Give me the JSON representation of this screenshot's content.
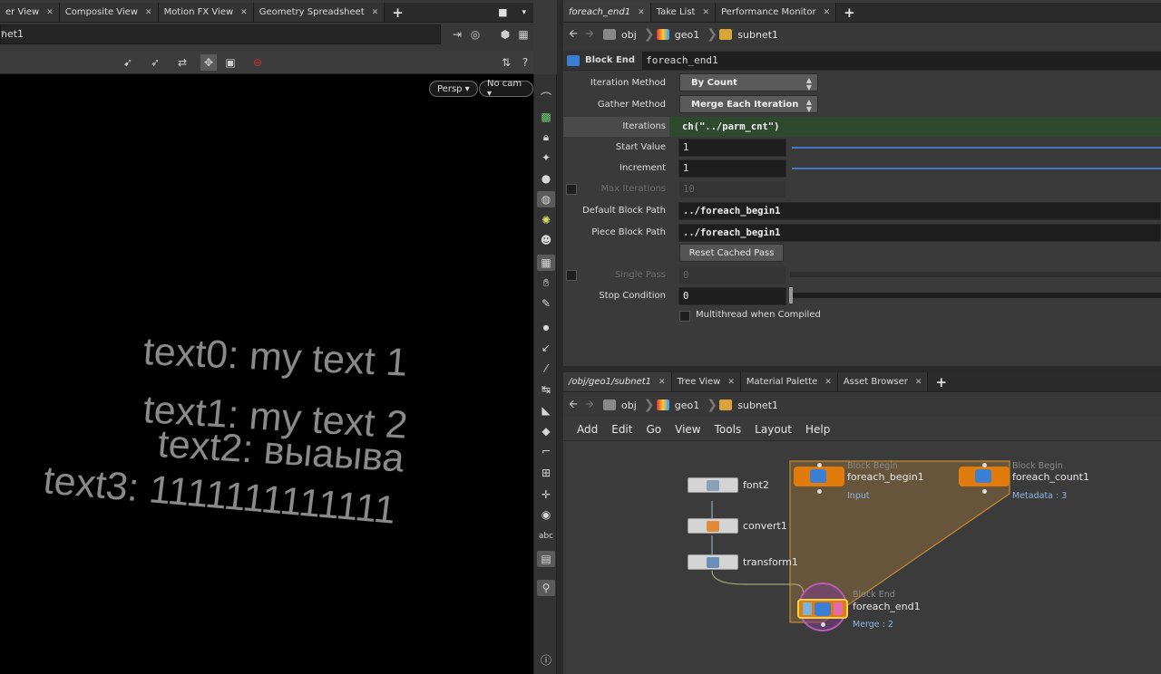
{
  "left_tabs": [
    {
      "label": "er View"
    },
    {
      "label": "Composite View"
    },
    {
      "label": "Motion FX View"
    },
    {
      "label": "Geometry Spreadsheet"
    }
  ],
  "left_path": {
    "value": "net1"
  },
  "viewport": {
    "persp": "Persp ▾",
    "cam": "No cam ▾",
    "texts": [
      "text0: my text 1",
      "text1: my text 2",
      "text2: выаыва",
      "text3: 1111111111111"
    ]
  },
  "right_tabs": [
    {
      "label": "foreach_end1"
    },
    {
      "label": "Take List"
    },
    {
      "label": "Performance Monitor"
    }
  ],
  "breadcrumbs": [
    "obj",
    "geo1",
    "subnet1"
  ],
  "params": {
    "node_type": "Block End",
    "node_name": "foreach_end1",
    "iteration_method_label": "Iteration Method",
    "iteration_method_value": "By Count",
    "gather_method_label": "Gather Method",
    "gather_method_value": "Merge Each Iteration",
    "iterations_label": "Iterations",
    "iterations_value": "ch(\"../parm_cnt\")",
    "start_value_label": "Start Value",
    "start_value": "1",
    "increment_label": "Increment",
    "increment_value": "1",
    "max_iterations_label": "Max Iterations",
    "max_iterations_value": "10",
    "default_block_path_label": "Default Block Path",
    "default_block_path_value": "../foreach_begin1",
    "piece_block_path_label": "Piece Block Path",
    "piece_block_path_value": "../foreach_begin1",
    "reset_button": "Reset Cached Pass",
    "single_pass_label": "Single Pass",
    "single_pass_value": "0",
    "stop_condition_label": "Stop Condition",
    "stop_condition_value": "0",
    "multithread_label": "Multithread when Compiled"
  },
  "net_tabs": [
    {
      "label": "/obj/geo1/subnet1"
    },
    {
      "label": "Tree View"
    },
    {
      "label": "Material Palette"
    },
    {
      "label": "Asset Browser"
    }
  ],
  "net_menu": [
    "Add",
    "Edit",
    "Go",
    "View",
    "Tools",
    "Layout",
    "Help"
  ],
  "nodes": {
    "font": "font2",
    "convert": "convert1",
    "transform": "transform1",
    "begin_type": "Block Begin",
    "begin": "foreach_begin1",
    "begin_sub": "Input",
    "count_type": "Block Begin",
    "count": "foreach_count1",
    "count_sub": "Metadata : 3",
    "end_type": "Block End",
    "end": "foreach_end1",
    "end_sub": "Merge : 2"
  },
  "colors": {
    "accent_blue": "#4776c2",
    "block_orange": "#e07b0c",
    "expression_green": "#2e4a2e"
  }
}
